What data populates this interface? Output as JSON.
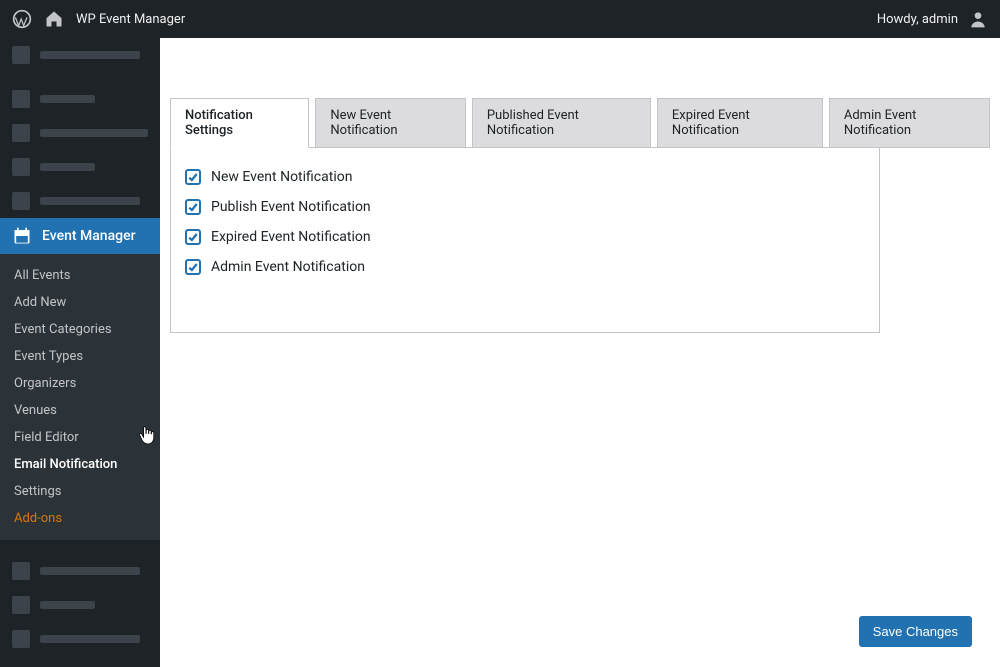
{
  "adminbar": {
    "site_title": "WP Event Manager",
    "howdy": "Howdy, admin"
  },
  "sidebar": {
    "active_label": "Event Manager",
    "submenu": [
      {
        "label": "All Events"
      },
      {
        "label": "Add New"
      },
      {
        "label": "Event Categories"
      },
      {
        "label": "Event Types"
      },
      {
        "label": "Organizers"
      },
      {
        "label": "Venues"
      },
      {
        "label": "Field Editor"
      },
      {
        "label": "Email Notification"
      },
      {
        "label": "Settings"
      },
      {
        "label": "Add-ons"
      }
    ]
  },
  "tabs": [
    {
      "label": "Notification Settings"
    },
    {
      "label": "New Event Notification"
    },
    {
      "label": "Published Event Notification"
    },
    {
      "label": "Expired Event Notification"
    },
    {
      "label": "Admin Event Notification"
    }
  ],
  "checks": [
    {
      "label": "New Event Notification"
    },
    {
      "label": "Publish Event Notification"
    },
    {
      "label": "Expired Event Notification"
    },
    {
      "label": "Admin Event Notification"
    }
  ],
  "save_label": "Save Changes"
}
